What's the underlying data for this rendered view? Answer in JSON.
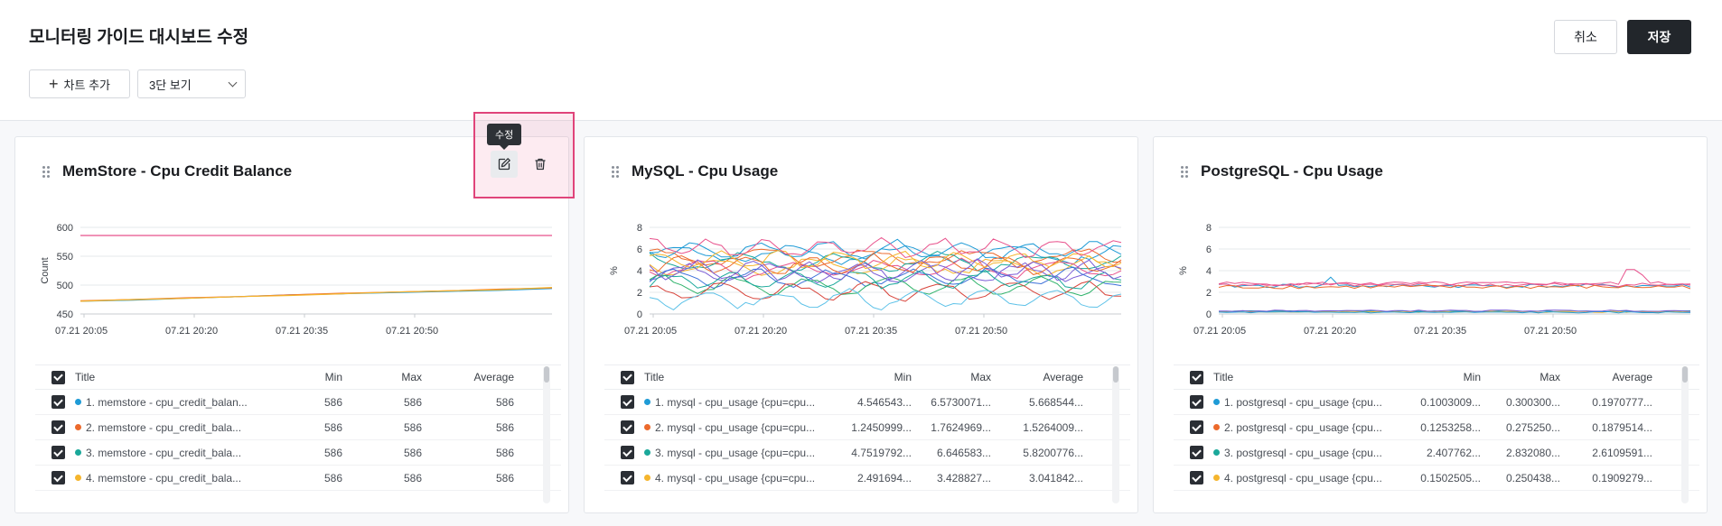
{
  "header": {
    "title": "모니터링 가이드 대시보드 수정",
    "cancel_label": "취소",
    "save_label": "저장",
    "add_chart_label": "차트 추가",
    "view_select_value": "3단 보기"
  },
  "toolbar_popup": {
    "tooltip": "수정"
  },
  "table_headers": {
    "title": "Title",
    "min": "Min",
    "max": "Max",
    "average": "Average"
  },
  "colors": {
    "blue": "#1f9bd6",
    "orange": "#ec6a2c",
    "teal": "#1aa89a",
    "yellow": "#f5b52d",
    "pink": "#e8528c",
    "accent": "#e0447a"
  },
  "cards": [
    {
      "title": "MemStore - Cpu Credit Balance",
      "chart_data": {
        "type": "line",
        "ylabel": "Count",
        "yticks": [
          "600",
          "550",
          "500",
          "450"
        ],
        "ylim": [
          450,
          600
        ],
        "xticks": [
          "07.21 20:05",
          "07.21 20:20",
          "07.21 20:35",
          "07.21 20:50"
        ],
        "series": [
          {
            "color": "#e8528c",
            "values": [
              586,
              586,
              586,
              586,
              586,
              586,
              586,
              586,
              586,
              586
            ]
          },
          {
            "color": "#1f9bd6",
            "values": [
              472,
              474,
              477,
              480,
              483,
              485,
              487,
              489,
              491,
              494
            ]
          },
          {
            "color": "#ec6a2c",
            "values": [
              473,
              475,
              478,
              480,
              483,
              486,
              488,
              490,
              493,
              495
            ]
          },
          {
            "color": "#f5b52d",
            "values": [
              472,
              475,
              477,
              480,
              482,
              485,
              488,
              490,
              492,
              496
            ]
          }
        ]
      },
      "rows": [
        {
          "title": "1. memstore - cpu_credit_balan...",
          "color": "#1f9bd6",
          "min": "586",
          "max": "586",
          "avg": "586"
        },
        {
          "title": "2. memstore - cpu_credit_bala...",
          "color": "#ec6a2c",
          "min": "586",
          "max": "586",
          "avg": "586"
        },
        {
          "title": "3. memstore - cpu_credit_bala...",
          "color": "#1aa89a",
          "min": "586",
          "max": "586",
          "avg": "586"
        },
        {
          "title": "4. memstore - cpu_credit_bala...",
          "color": "#f5b52d",
          "min": "586",
          "max": "586",
          "avg": "586"
        }
      ]
    },
    {
      "title": "MySQL - Cpu Usage",
      "chart_data": {
        "type": "line",
        "ylabel": "%",
        "yticks": [
          "8",
          "6",
          "4",
          "2",
          "0"
        ],
        "ylim": [
          0,
          8
        ],
        "xticks": [
          "07.21 20:05",
          "07.21 20:20",
          "07.21 20:35",
          "07.21 20:50"
        ]
      },
      "rows": [
        {
          "title": "1. mysql - cpu_usage {cpu=cpu...",
          "color": "#1f9bd6",
          "min": "4.546543...",
          "max": "6.5730071...",
          "avg": "5.668544..."
        },
        {
          "title": "2. mysql - cpu_usage {cpu=cpu...",
          "color": "#ec6a2c",
          "min": "1.2450999...",
          "max": "1.7624969...",
          "avg": "1.5264009..."
        },
        {
          "title": "3. mysql - cpu_usage {cpu=cpu...",
          "color": "#1aa89a",
          "min": "4.7519792...",
          "max": "6.646583...",
          "avg": "5.8200776..."
        },
        {
          "title": "4. mysql - cpu_usage {cpu=cpu...",
          "color": "#f5b52d",
          "min": "2.491694...",
          "max": "3.428827...",
          "avg": "3.041842..."
        }
      ]
    },
    {
      "title": "PostgreSQL - Cpu Usage",
      "chart_data": {
        "type": "line",
        "ylabel": "%",
        "yticks": [
          "8",
          "6",
          "4",
          "2",
          "0"
        ],
        "ylim": [
          0,
          8
        ],
        "xticks": [
          "07.21 20:05",
          "07.21 20:20",
          "07.21 20:35",
          "07.21 20:50"
        ]
      },
      "rows": [
        {
          "title": "1. postgresql - cpu_usage {cpu...",
          "color": "#1f9bd6",
          "min": "0.1003009...",
          "max": "0.300300...",
          "avg": "0.1970777..."
        },
        {
          "title": "2. postgresql - cpu_usage {cpu...",
          "color": "#ec6a2c",
          "min": "0.1253258...",
          "max": "0.275250...",
          "avg": "0.1879514..."
        },
        {
          "title": "3. postgresql - cpu_usage {cpu...",
          "color": "#1aa89a",
          "min": "2.407762...",
          "max": "2.832080...",
          "avg": "2.6109591..."
        },
        {
          "title": "4. postgresql - cpu_usage {cpu...",
          "color": "#f5b52d",
          "min": "0.1502505...",
          "max": "0.250438...",
          "avg": "0.1909279..."
        }
      ]
    }
  ]
}
